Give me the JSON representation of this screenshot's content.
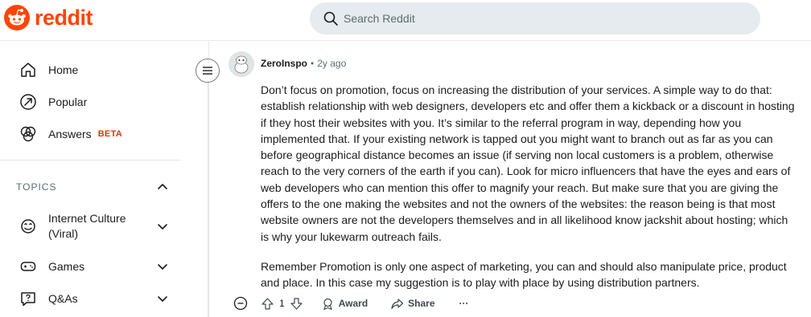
{
  "header": {
    "logo_text": "reddit",
    "search_placeholder": "Search Reddit"
  },
  "sidebar": {
    "items": [
      {
        "label": "Home",
        "icon": "home-icon"
      },
      {
        "label": "Popular",
        "icon": "popular-icon"
      },
      {
        "label": "Answers",
        "icon": "answers-icon",
        "badge": "BETA"
      }
    ],
    "topics_label": "TOPICS",
    "topics": [
      {
        "label": "Internet Culture (Viral)",
        "icon": "smiley-icon"
      },
      {
        "label": "Games",
        "icon": "gamepad-icon"
      },
      {
        "label": "Q&As",
        "icon": "qa-icon"
      }
    ]
  },
  "comment": {
    "author": "ZeroInspo",
    "separator": "•",
    "time": "2y ago",
    "paragraphs": [
      "Don’t focus on promotion, focus on increasing the distribution of your services. A simple way to do that: establish relationship with web designers, developers etc and offer them a kickback or a discount in hosting if they host their websites with you. It’s similar to the referral program in way, depending how you implemented that. If your existing network is tapped out you might want to branch out as far as you can before geographical distance becomes an issue (if serving non local customers is a problem, otherwise reach to the very corners of the earth if you can). Look for micro influencers that have the eyes and ears of web developers who can mention this offer to magnify your reach. But make sure that you are giving the offers to the one making the websites and not the owners of the websites: the reason being is that most website owners are not the developers themselves and in all likelihood know jackshit about hosting; which is why your lukewarm outreach fails.",
      "Remember Promotion is only one aspect of marketing, you can and should also manipulate price, product and place. In this case my suggestion is to play with place by using distribution partners."
    ],
    "vote_count": "1",
    "award_label": "Award",
    "share_label": "Share",
    "more_label": "···"
  },
  "colors": {
    "brand": "#ff4500",
    "beta": "#d93900",
    "search_bg": "#e5ebee",
    "muted": "#576f76"
  }
}
